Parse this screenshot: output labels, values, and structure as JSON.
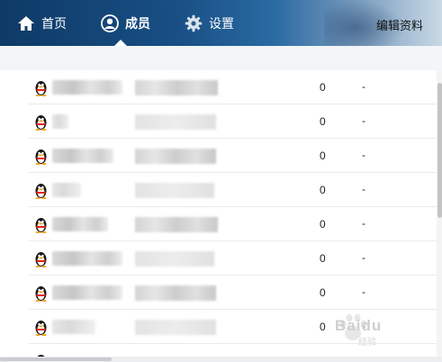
{
  "nav": {
    "home": {
      "label": "首页",
      "icon": "home-icon"
    },
    "members": {
      "label": "成员",
      "icon": "user-icon",
      "active": true
    },
    "settings": {
      "label": "设置",
      "icon": "gear-icon"
    },
    "edit_profile": "编辑资料"
  },
  "members": {
    "rows": [
      {
        "count": "0",
        "last": "-"
      },
      {
        "count": "0",
        "last": "-"
      },
      {
        "count": "0",
        "last": "-"
      },
      {
        "count": "0",
        "last": "-"
      },
      {
        "count": "0",
        "last": "-"
      },
      {
        "count": "0",
        "last": "-"
      },
      {
        "count": "0",
        "last": "-"
      },
      {
        "count": "0",
        "last": "-"
      }
    ]
  },
  "watermark": {
    "text": "Baidu",
    "sub": "经验"
  },
  "colors": {
    "topbar_dark": "#0e3a66",
    "topbar_light": "#c9d9e6",
    "subbar": "#f2f6f9"
  }
}
